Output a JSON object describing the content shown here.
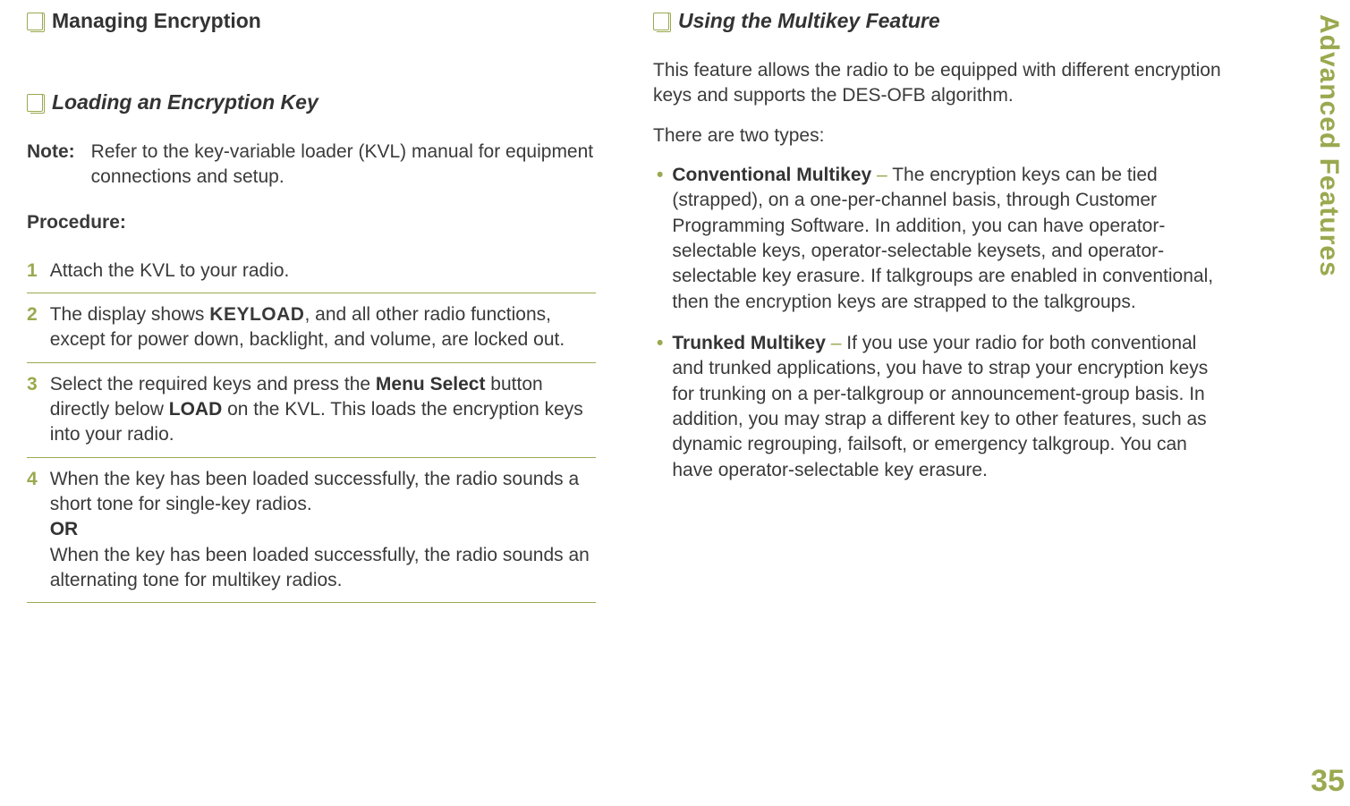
{
  "left": {
    "section_title": "Managing Encryption",
    "subsection_title": "Loading an Encryption Key",
    "note_label": "Note:",
    "note_text": "Refer to the key-variable loader (KVL) manual for equipment connections and setup.",
    "procedure_label": "Procedure:",
    "steps": {
      "s1_num": "1",
      "s1_text": "Attach the KVL to your radio.",
      "s2_num": "2",
      "s2_pre": "The display shows ",
      "s2_code": "KEYLOAD",
      "s2_post": ", and all other radio functions, except for power down, backlight, and volume, are locked out.",
      "s3_num": "3",
      "s3_a": "Select the required keys and press the ",
      "s3_b1": "Menu Select",
      "s3_b": " button directly below ",
      "s3_b2": "LOAD",
      "s3_c": " on the KVL. This loads the encryption keys into your radio.",
      "s4_num": "4",
      "s4_a": "When the key has been loaded successfully, the radio sounds a short tone for single-key radios.",
      "s4_or": "OR",
      "s4_b": "When the key has been loaded successfully, the radio sounds an alternating tone for multikey radios."
    }
  },
  "right": {
    "subsection_title": "Using the Multikey Feature",
    "p1": "This feature allows the radio to be equipped with different encryption keys and supports the DES-OFB algorithm.",
    "p2": "There are two types:",
    "b1_title": "Conventional Multikey",
    "b1_dash": " – ",
    "b1_text": "The encryption keys can be tied (strapped), on a one-per-channel basis, through Customer Programming Software. In addition, you can have operator-selectable keys, operator-selectable keysets, and operator-selectable key erasure. If talkgroups are enabled in conventional, then the encryption keys are strapped to the talkgroups.",
    "b2_title": "Trunked Multikey",
    "b2_dash": " – ",
    "b2_text": "If you use your radio for both conventional and trunked applications, you have to strap your encryption keys for trunking on a per-talkgroup or announcement-group basis. In addition, you may strap a different key to other features, such as dynamic regrouping, failsoft, or emergency talkgroup. You can have operator-selectable key erasure."
  },
  "side": {
    "label": "Advanced Features",
    "page_num": "35"
  }
}
